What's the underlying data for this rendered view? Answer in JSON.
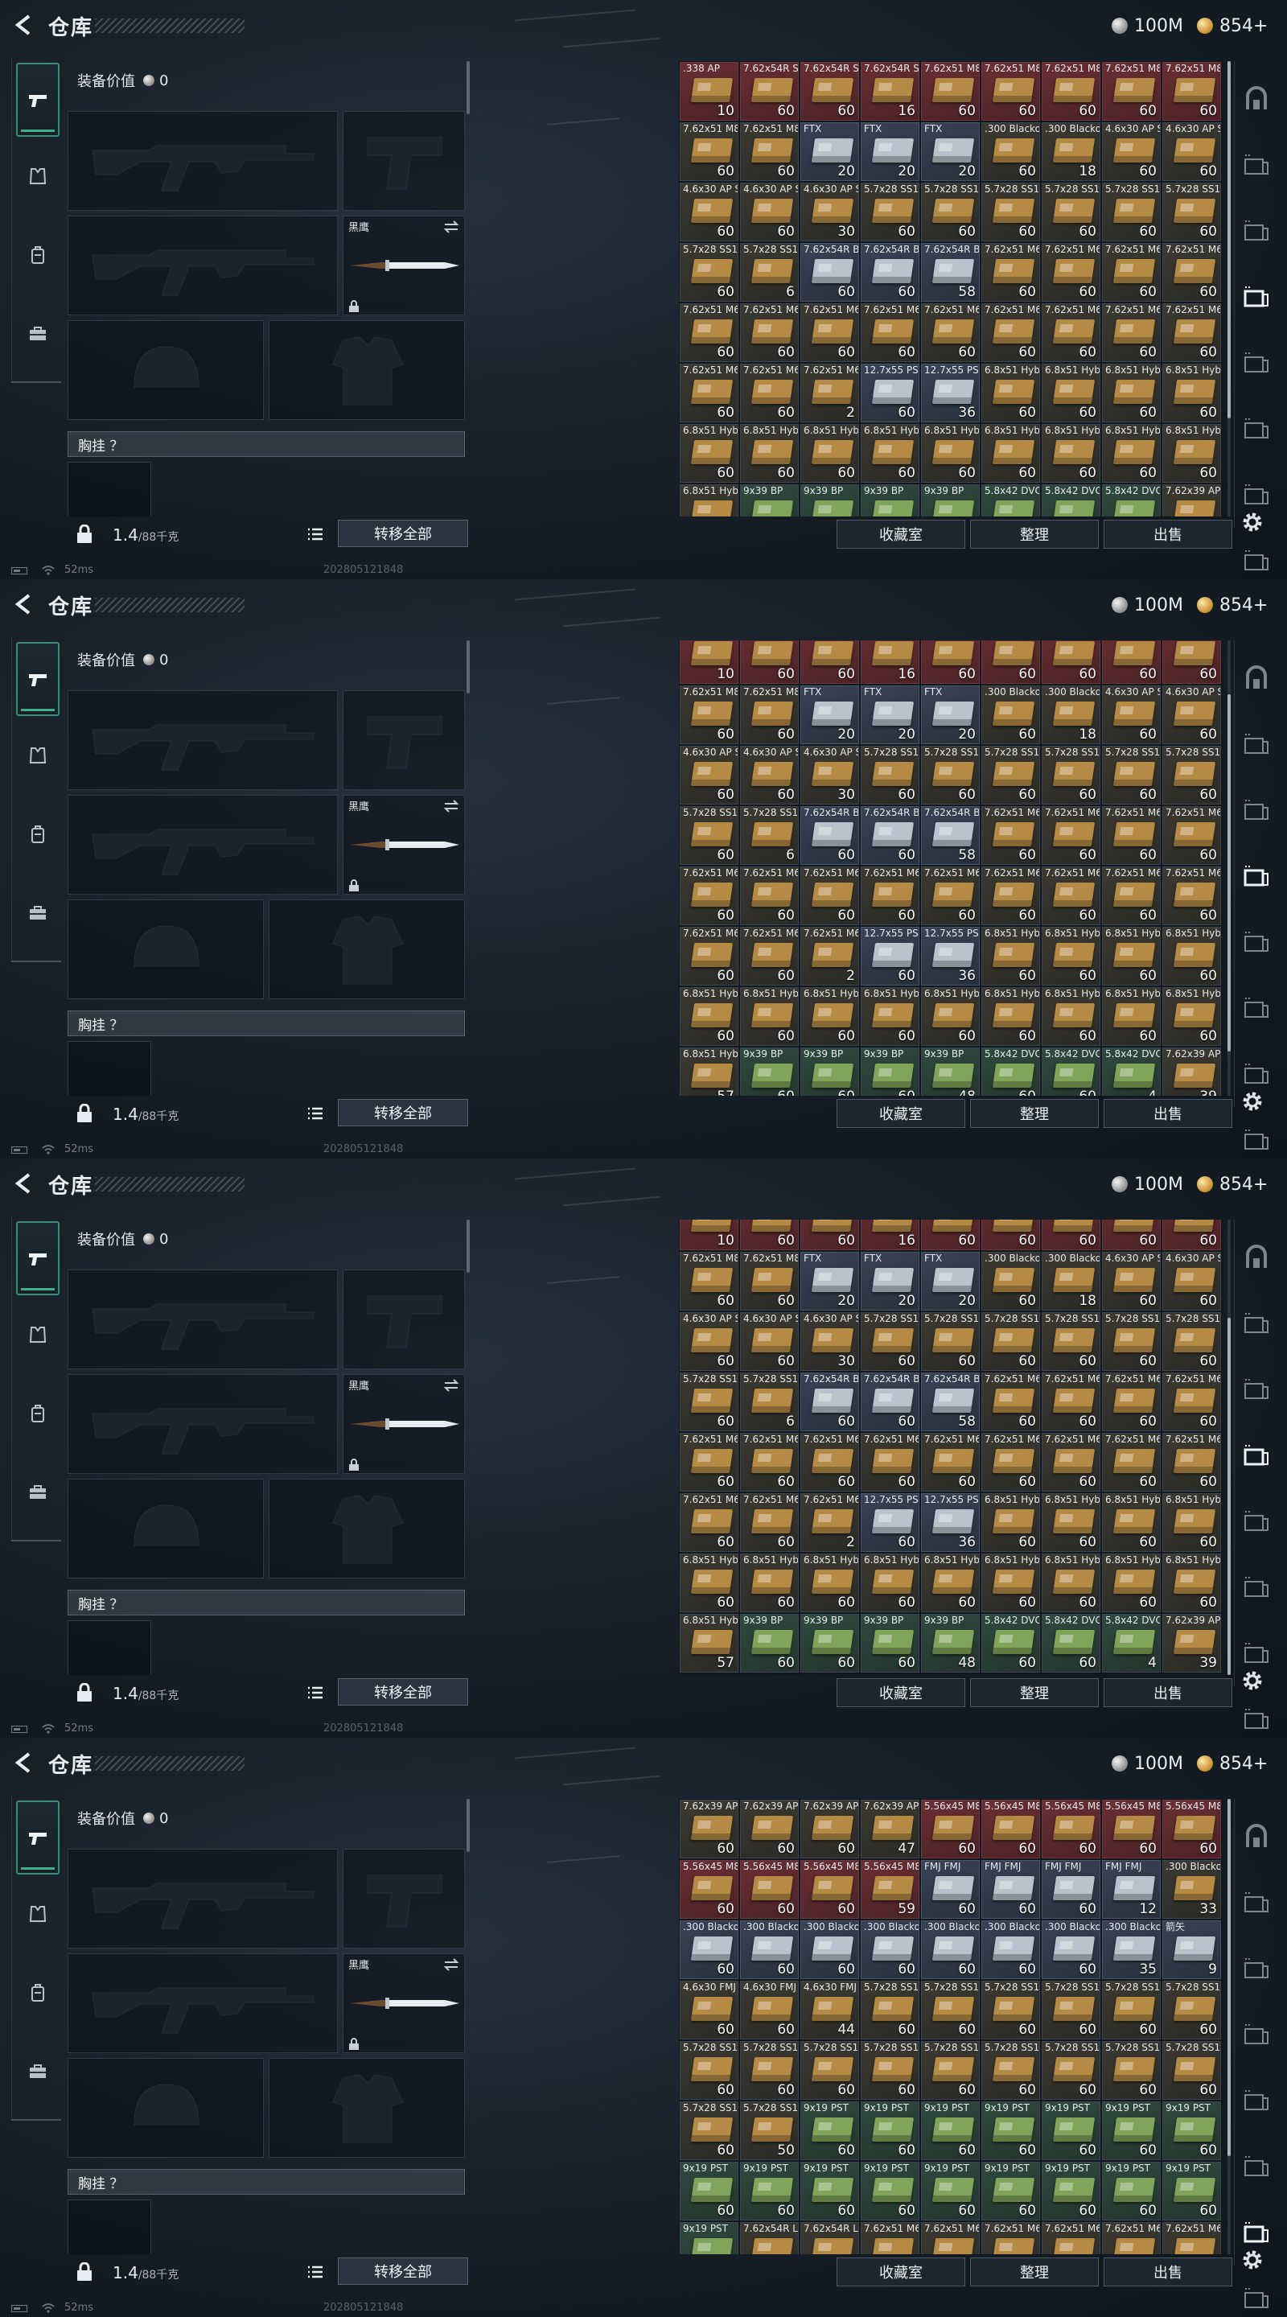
{
  "header": {
    "title": "仓库",
    "silver_amount": "100M",
    "gold_amount": "854+"
  },
  "equipment": {
    "value_label": "装备价值",
    "value_amount": "0",
    "knife_name": "黑鹰",
    "vest_label": "胸挂 ？",
    "weight": "1.4",
    "weight_max": "/88千克",
    "transfer_all": "转移全部"
  },
  "status": {
    "ping": "52ms",
    "uid": "202805121848"
  },
  "actions": {
    "favorites": "收藏室",
    "sort": "整理",
    "sell": "出售"
  },
  "panel_scroll_positions": [
    0,
    0.55,
    1.0,
    0
  ],
  "inventory_page_a": [
    [
      ".338 AP",
      "10",
      "red"
    ],
    [
      "7.62x54R SNB",
      "60",
      "red"
    ],
    [
      "7.62x54R SNB",
      "60",
      "red"
    ],
    [
      "7.62x54R SNB",
      "16",
      "red"
    ],
    [
      "7.62x51 M80",
      "60",
      "red"
    ],
    [
      "7.62x51 M80",
      "60",
      "red"
    ],
    [
      "7.62x51 M80",
      "60",
      "red"
    ],
    [
      "7.62x51 M80",
      "60",
      "red"
    ],
    [
      "7.62x51 M80",
      "60",
      "red"
    ],
    [
      "7.62x51 M80",
      "60",
      ""
    ],
    [
      "7.62x51 M80",
      "60",
      ""
    ],
    [
      "FTX",
      "20",
      "blue"
    ],
    [
      "FTX",
      "20",
      "blue"
    ],
    [
      "FTX",
      "20",
      "blue"
    ],
    [
      ".300 Blackout",
      "60",
      ""
    ],
    [
      ".300 Blackout",
      "18",
      ""
    ],
    [
      "4.6x30 AP SX",
      "60",
      ""
    ],
    [
      "4.6x30 AP SX",
      "60",
      ""
    ],
    [
      "4.6x30 AP SX",
      "60",
      ""
    ],
    [
      "4.6x30 AP SX",
      "60",
      ""
    ],
    [
      "4.6x30 AP SX",
      "30",
      ""
    ],
    [
      "5.7x28 SS190",
      "60",
      ""
    ],
    [
      "5.7x28 SS190",
      "60",
      ""
    ],
    [
      "5.7x28 SS190",
      "60",
      ""
    ],
    [
      "5.7x28 SS190",
      "60",
      ""
    ],
    [
      "5.7x28 SS190",
      "60",
      ""
    ],
    [
      "5.7x28 SS190",
      "60",
      ""
    ],
    [
      "5.7x28 SS190",
      "60",
      ""
    ],
    [
      "5.7x28 SS190",
      "6",
      ""
    ],
    [
      "7.62x54R BT",
      "60",
      "blue"
    ],
    [
      "7.62x54R BT",
      "60",
      "blue"
    ],
    [
      "7.62x54R BT",
      "58",
      "blue"
    ],
    [
      "7.62x51 M62",
      "60",
      ""
    ],
    [
      "7.62x51 M62",
      "60",
      ""
    ],
    [
      "7.62x51 M62",
      "60",
      ""
    ],
    [
      "7.62x51 M62",
      "60",
      ""
    ],
    [
      "7.62x51 M62",
      "60",
      ""
    ],
    [
      "7.62x51 M62",
      "60",
      ""
    ],
    [
      "7.62x51 M62",
      "60",
      ""
    ],
    [
      "7.62x51 M62",
      "60",
      ""
    ],
    [
      "7.62x51 M62",
      "60",
      ""
    ],
    [
      "7.62x51 M62",
      "60",
      ""
    ],
    [
      "7.62x51 M62",
      "60",
      ""
    ],
    [
      "7.62x51 M62",
      "60",
      ""
    ],
    [
      "7.62x51 M62",
      "60",
      ""
    ],
    [
      "7.62x51 M62",
      "60",
      ""
    ],
    [
      "7.62x51 M62",
      "60",
      ""
    ],
    [
      "7.62x51 M62",
      "2",
      ""
    ],
    [
      "12.7x55 PS12A",
      "60",
      "blue"
    ],
    [
      "12.7x55 PS12A",
      "36",
      "blue"
    ],
    [
      "6.8x51 Hybrid",
      "60",
      ""
    ],
    [
      "6.8x51 Hybrid",
      "60",
      ""
    ],
    [
      "6.8x51 Hybrid",
      "60",
      ""
    ],
    [
      "6.8x51 Hybrid",
      "60",
      ""
    ],
    [
      "6.8x51 Hybrid",
      "60",
      ""
    ],
    [
      "6.8x51 Hybrid",
      "60",
      ""
    ],
    [
      "6.8x51 Hybrid",
      "60",
      ""
    ],
    [
      "6.8x51 Hybrid",
      "60",
      ""
    ],
    [
      "6.8x51 Hybrid",
      "60",
      ""
    ],
    [
      "6.8x51 Hybrid",
      "60",
      ""
    ],
    [
      "6.8x51 Hybrid",
      "60",
      ""
    ],
    [
      "6.8x51 Hybrid",
      "60",
      ""
    ],
    [
      "6.8x51 Hybrid",
      "60",
      ""
    ],
    [
      "6.8x51 Hybrid",
      "57",
      ""
    ],
    [
      "9x39 BP",
      "60",
      "green"
    ],
    [
      "9x39 BP",
      "60",
      "green"
    ],
    [
      "9x39 BP",
      "60",
      "green"
    ],
    [
      "9x39 BP",
      "48",
      "green"
    ],
    [
      "5.8x42 DVC12",
      "60",
      "green"
    ],
    [
      "5.8x42 DVC12",
      "60",
      "green"
    ],
    [
      "5.8x42 DVC12",
      "4",
      "green"
    ],
    [
      "7.62x39 AP",
      "39",
      ""
    ]
  ],
  "inventory_page_b": [
    [
      "7.62x39 AP",
      "60",
      ""
    ],
    [
      "7.62x39 AP",
      "60",
      ""
    ],
    [
      "7.62x39 AP",
      "60",
      ""
    ],
    [
      "7.62x39 AP",
      "47",
      ""
    ],
    [
      "5.56x45 M855",
      "60",
      "red"
    ],
    [
      "5.56x45 M855",
      "60",
      "red"
    ],
    [
      "5.56x45 M855",
      "60",
      "red"
    ],
    [
      "5.56x45 M855",
      "60",
      "red"
    ],
    [
      "5.56x45 M855",
      "60",
      "red"
    ],
    [
      "5.56x45 M855",
      "60",
      "red"
    ],
    [
      "5.56x45 M855",
      "60",
      "red"
    ],
    [
      "5.56x45 M855",
      "60",
      "red"
    ],
    [
      "5.56x45 M855",
      "59",
      "red"
    ],
    [
      "FMJ FMJ",
      "60",
      "blue"
    ],
    [
      "FMJ FMJ",
      "60",
      "blue"
    ],
    [
      "FMJ FMJ",
      "60",
      "blue"
    ],
    [
      "FMJ FMJ",
      "12",
      "blue"
    ],
    [
      ".300 Blackout",
      "33",
      ""
    ],
    [
      ".300 Blackout",
      "60",
      "blue"
    ],
    [
      ".300 Blackout",
      "60",
      "blue"
    ],
    [
      ".300 Blackout",
      "60",
      "blue"
    ],
    [
      ".300 Blackout",
      "60",
      "blue"
    ],
    [
      ".300 Blackout",
      "60",
      "blue"
    ],
    [
      ".300 Blackout",
      "60",
      "blue"
    ],
    [
      ".300 Blackout",
      "60",
      "blue"
    ],
    [
      ".300 Blackout",
      "35",
      "blue"
    ],
    [
      "箭矢",
      "9",
      "blue"
    ],
    [
      "4.6x30 FMJ SX",
      "60",
      ""
    ],
    [
      "4.6x30 FMJ SX",
      "60",
      ""
    ],
    [
      "4.6x30 FMJ SX",
      "44",
      ""
    ],
    [
      "5.7x28 SS197",
      "60",
      ""
    ],
    [
      "5.7x28 SS197",
      "60",
      ""
    ],
    [
      "5.7x28 SS197",
      "60",
      ""
    ],
    [
      "5.7x28 SS197",
      "60",
      ""
    ],
    [
      "5.7x28 SS197",
      "60",
      ""
    ],
    [
      "5.7x28 SS197",
      "60",
      ""
    ],
    [
      "5.7x28 SS198",
      "60",
      ""
    ],
    [
      "5.7x28 SS198",
      "60",
      ""
    ],
    [
      "5.7x28 SS198",
      "60",
      ""
    ],
    [
      "5.7x28 SS198",
      "60",
      ""
    ],
    [
      "5.7x28 SS198",
      "60",
      ""
    ],
    [
      "5.7x28 SS198",
      "60",
      ""
    ],
    [
      "5.7x28 SS198",
      "60",
      ""
    ],
    [
      "5.7x28 SS198",
      "60",
      ""
    ],
    [
      "5.7x28 SS198",
      "60",
      ""
    ],
    [
      "5.7x28 SS198",
      "60",
      ""
    ],
    [
      "5.7x28 SS198",
      "50",
      ""
    ],
    [
      "9x19 PST",
      "60",
      "green"
    ],
    [
      "9x19 PST",
      "60",
      "green"
    ],
    [
      "9x19 PST",
      "60",
      "green"
    ],
    [
      "9x19 PST",
      "60",
      "green"
    ],
    [
      "9x19 PST",
      "60",
      "green"
    ],
    [
      "9x19 PST",
      "60",
      "green"
    ],
    [
      "9x19 PST",
      "60",
      "green"
    ],
    [
      "9x19 PST",
      "60",
      "green"
    ],
    [
      "9x19 PST",
      "60",
      "green"
    ],
    [
      "9x19 PST",
      "60",
      "green"
    ],
    [
      "9x19 PST",
      "60",
      "green"
    ],
    [
      "9x19 PST",
      "60",
      "green"
    ],
    [
      "9x19 PST",
      "60",
      "green"
    ],
    [
      "9x19 PST",
      "60",
      "green"
    ],
    [
      "9x19 PST",
      "60",
      "green"
    ],
    [
      "9x19 PST",
      "60",
      "green"
    ],
    [
      "9x19 PST",
      "60",
      "green"
    ],
    [
      "7.62x54R LPS",
      "60",
      ""
    ],
    [
      "7.62x54R LPS",
      "60",
      ""
    ],
    [
      "7.62x51 M61",
      "60",
      ""
    ],
    [
      "7.62x51 M61",
      "60",
      ""
    ],
    [
      "7.62x51 M61",
      "60",
      ""
    ],
    [
      "7.62x51 M61",
      "60",
      ""
    ],
    [
      "7.62x51 M61",
      "60",
      ""
    ],
    [
      "7.62x51 M61",
      "60",
      ""
    ]
  ],
  "colors": {
    "accent": "#3fae88",
    "gold": "#c99638"
  },
  "icons": [
    "back-arrow-icon",
    "silver-coin-icon",
    "gold-coin-icon",
    "pistol-icon",
    "armor-icon",
    "backpack-icon",
    "briefcase-icon",
    "rifle-icon",
    "knife-icon",
    "swap-icon",
    "lock-icon",
    "list-icon",
    "gear-icon",
    "helmet-icon",
    "jacket-icon",
    "safebox-icon",
    "container-icon"
  ]
}
